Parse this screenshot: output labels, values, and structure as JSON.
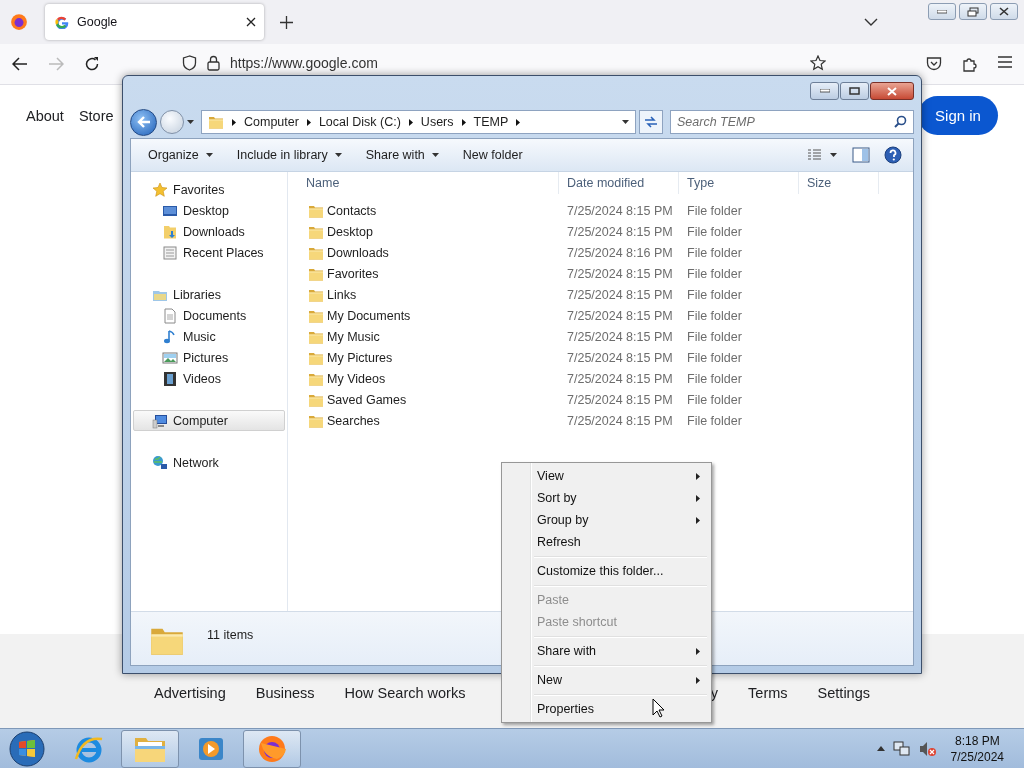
{
  "browser": {
    "tab": {
      "title": "Google",
      "selected": true
    },
    "url": "https://www.google.com"
  },
  "google": {
    "header_links": [
      "About",
      "Store"
    ],
    "sign_in": "Sign in",
    "footer_left": [
      "Advertising",
      "Business",
      "How Search works"
    ],
    "footer_right": [
      "y",
      "Terms",
      "Settings"
    ]
  },
  "explorer": {
    "breadcrumb": [
      "Computer",
      "Local Disk (C:)",
      "Users",
      "TEMP"
    ],
    "search": {
      "placeholder": "Search TEMP"
    },
    "toolbar": [
      {
        "label": "Organize",
        "dropdown": true
      },
      {
        "label": "Include in library",
        "dropdown": true
      },
      {
        "label": "Share with",
        "dropdown": true
      },
      {
        "label": "New folder",
        "dropdown": false
      }
    ],
    "nav": [
      {
        "label": "Favorites",
        "kind": "star",
        "selected": false,
        "children": [
          {
            "label": "Desktop",
            "kind": "desktop",
            "selected": false
          },
          {
            "label": "Downloads",
            "kind": "downloads",
            "selected": false
          },
          {
            "label": "Recent Places",
            "kind": "recent",
            "selected": false
          }
        ]
      },
      {
        "label": "Libraries",
        "kind": "library",
        "selected": false,
        "children": [
          {
            "label": "Documents",
            "kind": "document",
            "selected": false
          },
          {
            "label": "Music",
            "kind": "music",
            "selected": false
          },
          {
            "label": "Pictures",
            "kind": "pictures",
            "selected": false
          },
          {
            "label": "Videos",
            "kind": "videos",
            "selected": false
          }
        ]
      },
      {
        "label": "Computer",
        "kind": "computer",
        "selected": true
      },
      {
        "label": "Network",
        "kind": "network",
        "selected": false
      }
    ],
    "columns": [
      "Name",
      "Date modified",
      "Type",
      "Size"
    ],
    "rows": [
      {
        "name": "Contacts",
        "date": "7/25/2024 8:15 PM",
        "type": "File folder"
      },
      {
        "name": "Desktop",
        "date": "7/25/2024 8:15 PM",
        "type": "File folder"
      },
      {
        "name": "Downloads",
        "date": "7/25/2024 8:16 PM",
        "type": "File folder"
      },
      {
        "name": "Favorites",
        "date": "7/25/2024 8:15 PM",
        "type": "File folder"
      },
      {
        "name": "Links",
        "date": "7/25/2024 8:15 PM",
        "type": "File folder"
      },
      {
        "name": "My Documents",
        "date": "7/25/2024 8:15 PM",
        "type": "File folder"
      },
      {
        "name": "My Music",
        "date": "7/25/2024 8:15 PM",
        "type": "File folder"
      },
      {
        "name": "My Pictures",
        "date": "7/25/2024 8:15 PM",
        "type": "File folder"
      },
      {
        "name": "My Videos",
        "date": "7/25/2024 8:15 PM",
        "type": "File folder"
      },
      {
        "name": "Saved Games",
        "date": "7/25/2024 8:15 PM",
        "type": "File folder"
      },
      {
        "name": "Searches",
        "date": "7/25/2024 8:15 PM",
        "type": "File folder"
      }
    ],
    "status": "11 items"
  },
  "context_menu": {
    "groups": [
      {
        "items": [
          {
            "label": "View",
            "submenu": true,
            "disabled": false
          },
          {
            "label": "Sort by",
            "submenu": true,
            "disabled": false
          },
          {
            "label": "Group by",
            "submenu": true,
            "disabled": false
          },
          {
            "label": "Refresh",
            "submenu": false,
            "disabled": false
          }
        ]
      },
      {
        "items": [
          {
            "label": "Customize this folder...",
            "submenu": false,
            "disabled": false
          }
        ]
      },
      {
        "items": [
          {
            "label": "Paste",
            "submenu": false,
            "disabled": true
          },
          {
            "label": "Paste shortcut",
            "submenu": false,
            "disabled": true
          }
        ]
      },
      {
        "items": [
          {
            "label": "Share with",
            "submenu": true,
            "disabled": false
          }
        ]
      },
      {
        "items": [
          {
            "label": "New",
            "submenu": true,
            "disabled": false
          }
        ]
      },
      {
        "items": [
          {
            "label": "Properties",
            "submenu": false,
            "disabled": false
          }
        ]
      }
    ]
  },
  "taskbar": {
    "buttons": [
      {
        "kind": "ie",
        "active": false
      },
      {
        "kind": "explorer",
        "active": true
      },
      {
        "kind": "media",
        "active": false
      },
      {
        "kind": "firefox",
        "active": true
      }
    ],
    "clock": {
      "time": "8:18 PM",
      "date": "7/25/2024"
    }
  }
}
